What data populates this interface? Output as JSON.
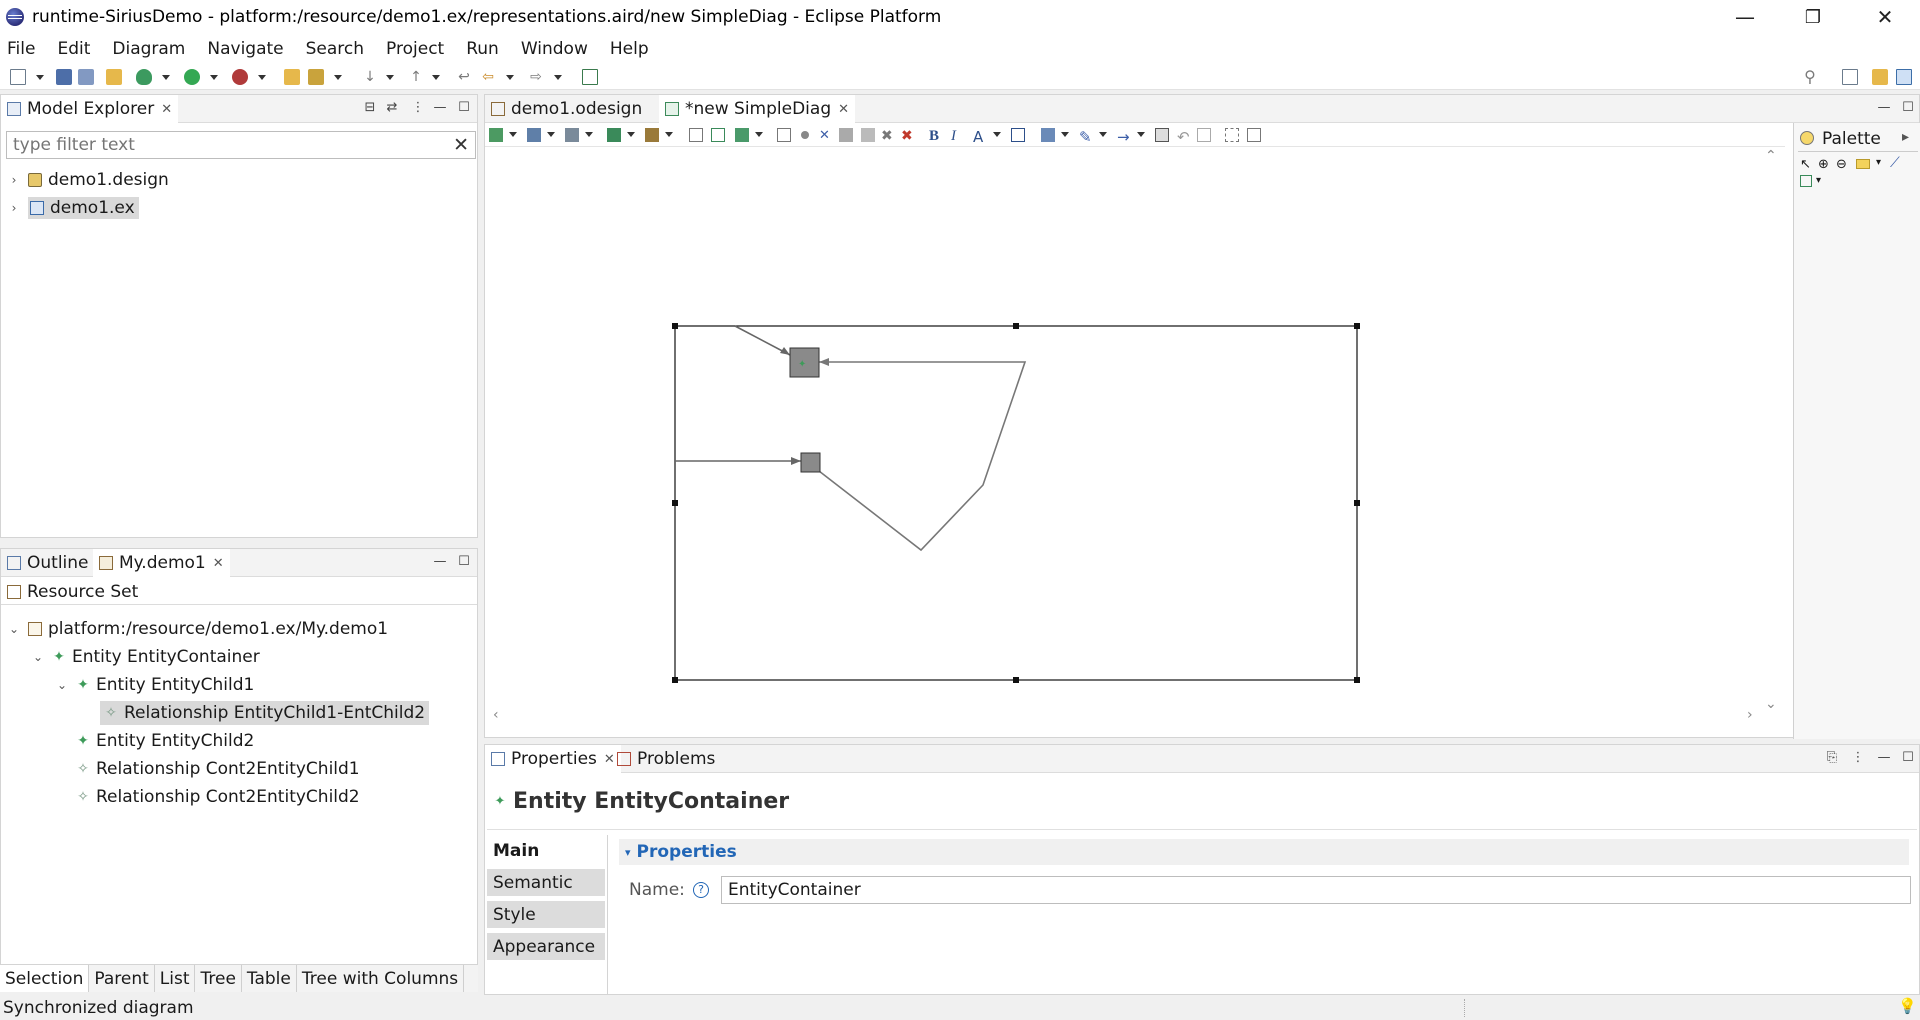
{
  "window": {
    "title": "runtime-SiriusDemo - platform:/resource/demo1.ex/representations.aird/new SimpleDiag - Eclipse Platform",
    "minimize": "—",
    "restore": "❐",
    "close": "✕"
  },
  "menu": [
    "File",
    "Edit",
    "Diagram",
    "Navigate",
    "Search",
    "Project",
    "Run",
    "Window",
    "Help"
  ],
  "model_explorer": {
    "tab_label": "Model Explorer",
    "filter_placeholder": "type filter text",
    "items": [
      {
        "label": "demo1.design",
        "icon": "project-folder-icon"
      },
      {
        "label": "demo1.ex",
        "icon": "modeling-project-icon"
      }
    ]
  },
  "outline": {
    "tabs": [
      "Outline",
      "My.demo1"
    ],
    "header": "Resource Set",
    "rows": [
      {
        "label": "platform:/resource/demo1.ex/My.demo1",
        "level": 0,
        "expanded": true,
        "icon": "resource-icon"
      },
      {
        "label": "Entity EntityContainer",
        "level": 1,
        "expanded": true,
        "icon": "entity-icon"
      },
      {
        "label": "Entity EntityChild1",
        "level": 2,
        "expanded": true,
        "icon": "entity-icon"
      },
      {
        "label": "Relationship EntityChild1-EntChild2",
        "level": 3,
        "expanded": null,
        "icon": "relationship-icon",
        "selected": true
      },
      {
        "label": "Entity EntityChild2",
        "level": 2,
        "expanded": null,
        "icon": "entity-icon"
      },
      {
        "label": "Relationship Cont2EntityChild1",
        "level": 2,
        "expanded": null,
        "icon": "relationship-icon"
      },
      {
        "label": "Relationship Cont2EntityChild2",
        "level": 2,
        "expanded": null,
        "icon": "relationship-icon"
      }
    ],
    "bottom_tabs": [
      "Selection",
      "Parent",
      "List",
      "Tree",
      "Table",
      "Tree with Columns"
    ]
  },
  "editor": {
    "tabs": [
      {
        "label": "demo1.odesign",
        "active": false
      },
      {
        "label": "*new SimpleDiag",
        "active": true
      }
    ],
    "palette_title": "Palette"
  },
  "properties": {
    "tabs": [
      "Properties",
      "Problems"
    ],
    "title": "Entity EntityContainer",
    "side_tabs": [
      "Main",
      "Semantic",
      "Style",
      "Appearance"
    ],
    "section": "Properties",
    "name_label": "Name:",
    "name_value": "EntityContainer"
  },
  "statusbar": {
    "text": "Synchronized diagram"
  }
}
